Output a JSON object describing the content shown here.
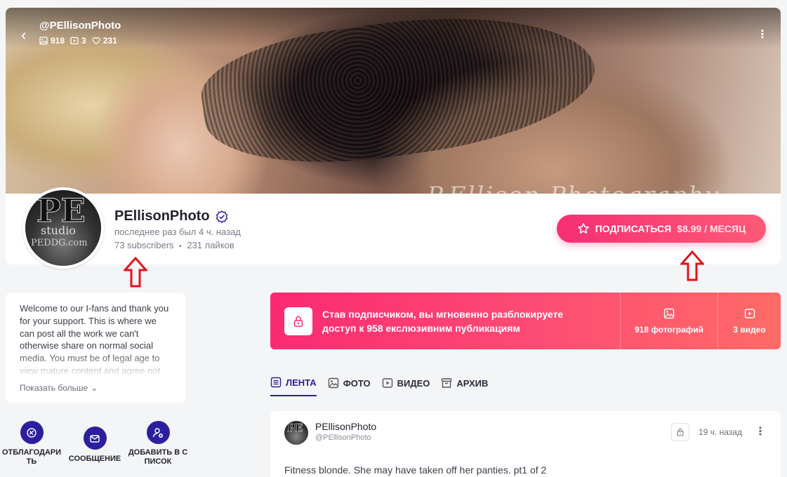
{
  "header": {
    "handle": "@PEllisonPhoto",
    "stats": {
      "photos": "918",
      "videos": "3",
      "likes": "231"
    },
    "watermark": "P.Ellison Photography"
  },
  "profile": {
    "name": "PEllisonPhoto",
    "last_seen": "последнее раз был 4 ч. назад",
    "subscribers": "73 subscribers",
    "separator": "•",
    "likes": "231 лайков",
    "avatar_logo": {
      "pe": "PE",
      "studio": "studio",
      "url": "PEDDG.com"
    }
  },
  "subscribe": {
    "label": "ПОДПИСАТЬСЯ",
    "price": "$8.99 / МЕСЯЦ"
  },
  "about": {
    "text": "Welcome to our I-fans and thank you for your support. This is where we can post all the work we can't otherwise share on normal social media. You must be of legal age to view mature content and agree not",
    "show_more": "Показать больше"
  },
  "actions": [
    {
      "label": "ОТБЛАГОДАРИТЬ"
    },
    {
      "label": "СООБЩЕНИЕ"
    },
    {
      "label": "ДОБАВИТЬ В СПИСОК"
    }
  ],
  "unlock": {
    "text_line1": "Став подписчиком, вы мгновенно разблокируете",
    "text_line2": "доступ к 958 екслюзивним публикациям",
    "photos": "918 фотографий",
    "videos": "3 видео"
  },
  "tabs": [
    {
      "label": "ЛЕНТА",
      "active": true
    },
    {
      "label": "ФОТО"
    },
    {
      "label": "ВИДЕО"
    },
    {
      "label": "АРХИВ"
    }
  ],
  "post": {
    "author": "PEllisonPhoto",
    "handle": "@PEllisonPhoto",
    "time": "19 ч. назад",
    "text": "Fitness blonde. She may have taken off her panties. pt1 of 2"
  },
  "colors": {
    "accent": "#2b1fa0",
    "subscribe_gradient_start": "#f52f73",
    "subscribe_gradient_end": "#fe5a77",
    "annotation_arrow": "#e3131b"
  }
}
